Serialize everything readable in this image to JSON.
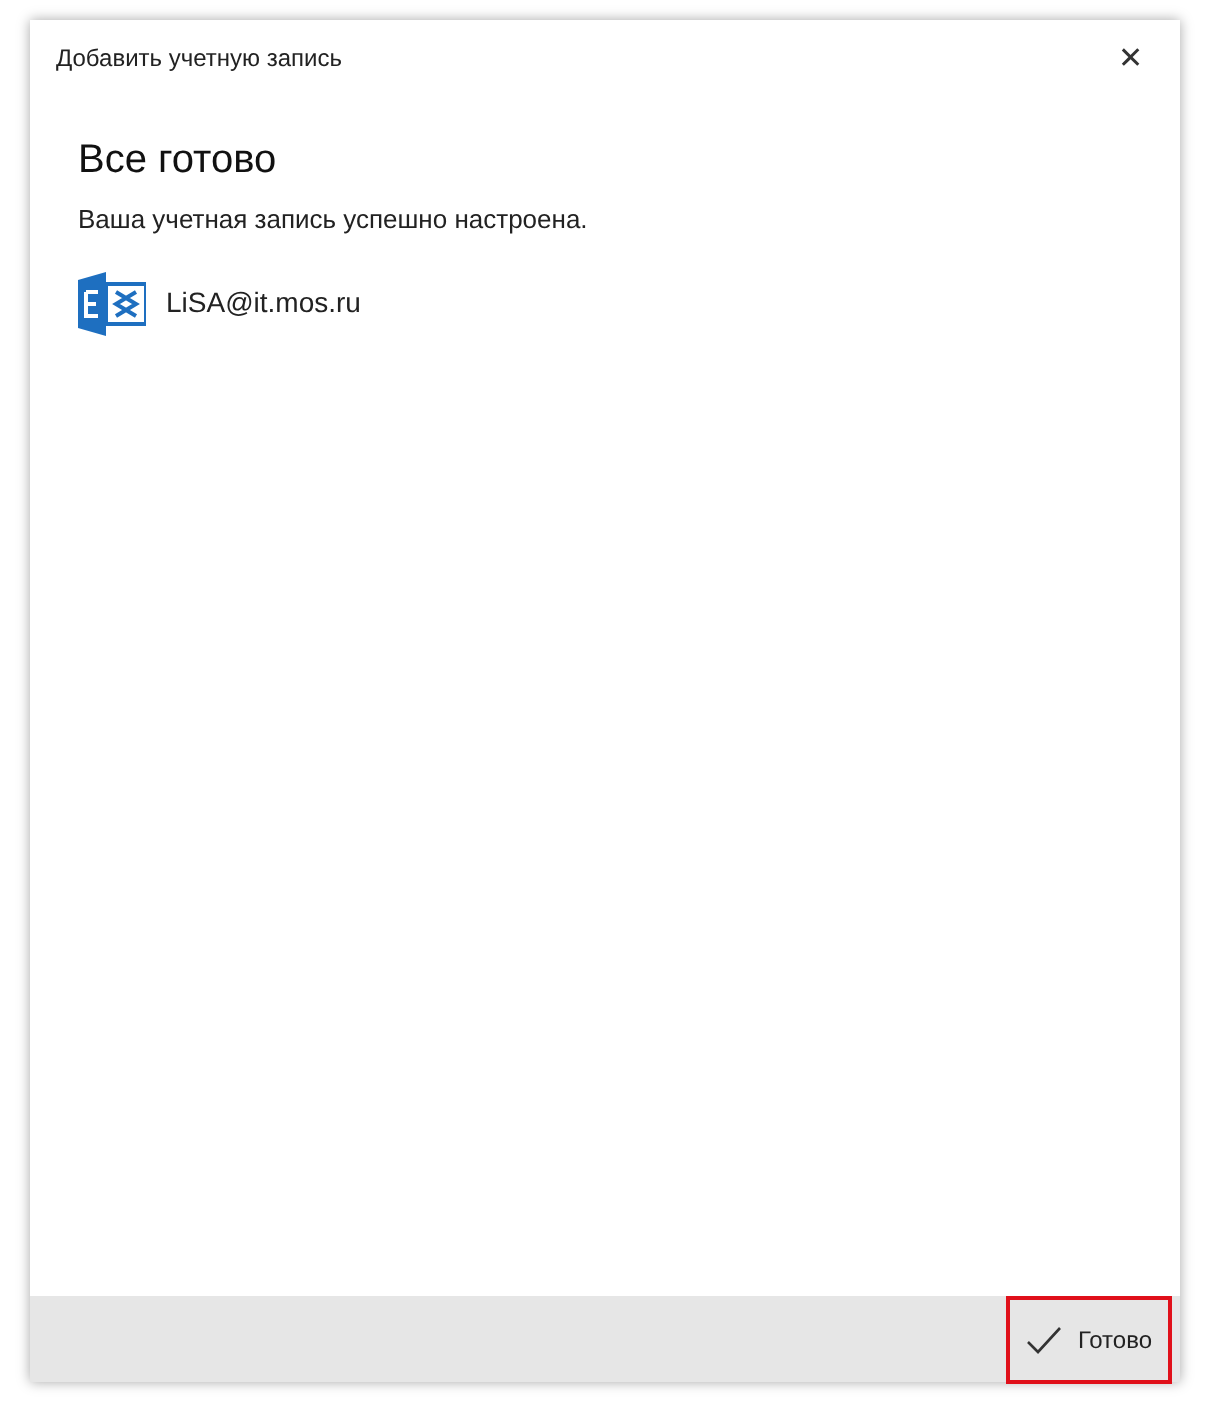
{
  "window": {
    "title": "Добавить учетную запись",
    "close": "✕"
  },
  "heading": "Все готово",
  "message": "Ваша учетная запись успешно настроена.",
  "account": {
    "email": "LiSA@it.mos.ru"
  },
  "footer": {
    "button": {
      "label": "Готово",
      "highlighted": true
    }
  }
}
